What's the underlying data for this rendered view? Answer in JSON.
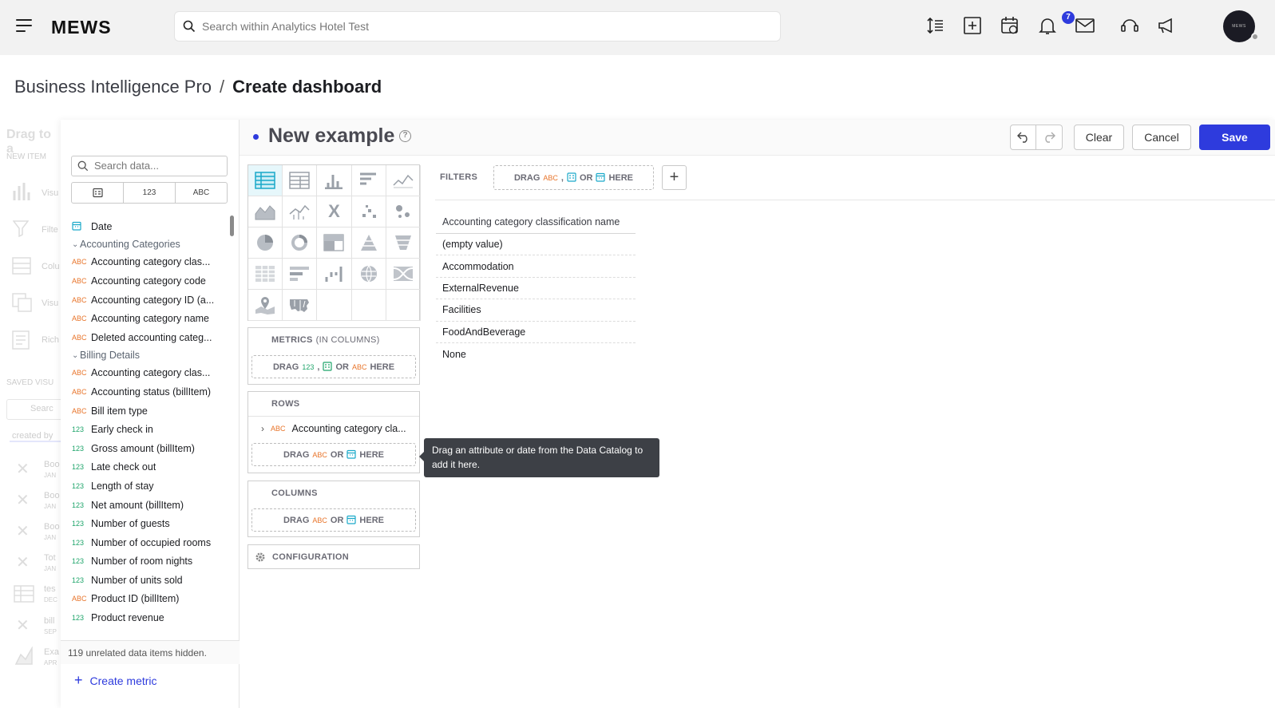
{
  "topbar": {
    "brand": "MEWS",
    "search_placeholder": "Search within Analytics Hotel Test",
    "notification_count": "7",
    "avatar_text": "MEWS"
  },
  "breadcrumb": {
    "parent": "Business Intelligence Pro",
    "separator": "/",
    "current": "Create dashboard"
  },
  "background_sidebar": {
    "texts": [
      "Drag to a",
      "NEW ITEM",
      "Visu",
      "Filte",
      "Colu",
      "Visu",
      "Rich",
      "SAVED VISU",
      "Searc",
      "created by",
      "Boo",
      "JAN",
      "Boo",
      "JAN",
      "Boo",
      "JAN",
      "Tot",
      "JAN",
      "tes",
      "DEC",
      "bill",
      "SEP",
      "Exa",
      "APR"
    ]
  },
  "catalog": {
    "search_placeholder": "Search data...",
    "filters": {
      "numeric": "123",
      "text": "ABC"
    },
    "date_item": "Date",
    "groups": [
      {
        "name": "Accounting Categories",
        "items": [
          {
            "type": "ABC",
            "label": "Accounting category clas..."
          },
          {
            "type": "ABC",
            "label": "Accounting category code"
          },
          {
            "type": "ABC",
            "label": "Accounting category ID (a..."
          },
          {
            "type": "ABC",
            "label": "Accounting category name"
          },
          {
            "type": "ABC",
            "label": "Deleted accounting categ..."
          }
        ]
      },
      {
        "name": "Billing Details",
        "items": [
          {
            "type": "ABC",
            "label": "Accounting category clas..."
          },
          {
            "type": "ABC",
            "label": "Accounting status (billItem)"
          },
          {
            "type": "ABC",
            "label": "Bill item type"
          },
          {
            "type": "123",
            "label": "Early check in"
          },
          {
            "type": "123",
            "label": "Gross amount (billItem)"
          },
          {
            "type": "123",
            "label": "Late check out"
          },
          {
            "type": "123",
            "label": "Length of stay"
          },
          {
            "type": "123",
            "label": "Net amount (billItem)"
          },
          {
            "type": "123",
            "label": "Number of guests"
          },
          {
            "type": "123",
            "label": "Number of occupied rooms"
          },
          {
            "type": "123",
            "label": "Number of room nights"
          },
          {
            "type": "123",
            "label": "Number of units sold"
          },
          {
            "type": "ABC",
            "label": "Product ID (billItem)"
          },
          {
            "type": "123",
            "label": "Product revenue"
          }
        ]
      }
    ],
    "hidden_note": "119 unrelated data items hidden.",
    "create_metric": "Create metric"
  },
  "editor": {
    "title": "New example",
    "help": "?",
    "clear": "Clear",
    "cancel": "Cancel",
    "save": "Save"
  },
  "buckets": {
    "metrics_title": "METRICS",
    "metrics_sub": "(IN COLUMNS)",
    "rows_title": "ROWS",
    "columns_title": "COLUMNS",
    "configuration": "CONFIGURATION",
    "drag": "DRAG",
    "or": "OR",
    "here": "HERE",
    "comma": ",",
    "tok_123": "123",
    "tok_abc": "ABC",
    "row_item": {
      "type": "ABC",
      "label": "Accounting category cla..."
    }
  },
  "tooltip": "Drag an attribute or date from the Data Catalog to add it here.",
  "filters": {
    "label": "FILTERS"
  },
  "result": {
    "header": "Accounting category classification name",
    "rows": [
      "(empty value)",
      "Accommodation",
      "ExternalRevenue",
      "Facilities",
      "FoodAndBeverage",
      "None"
    ]
  },
  "colors": {
    "accent": "#2e3bdd",
    "abc": "#e8742a",
    "numeric": "#1fa56b",
    "teal": "#1aa9c9"
  }
}
